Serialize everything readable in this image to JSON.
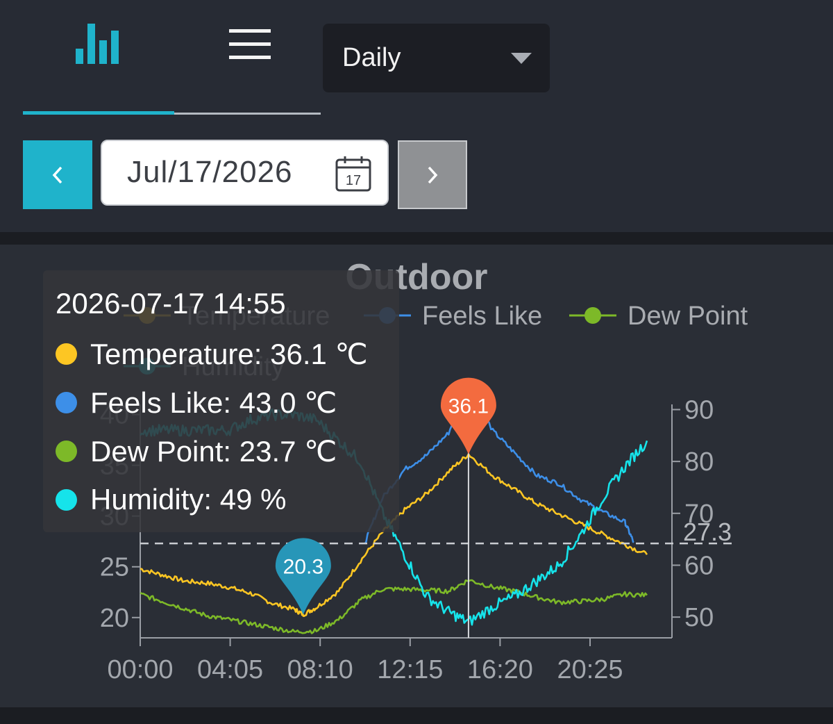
{
  "tabs": [
    {
      "name": "chart",
      "icon": "bar-chart-icon",
      "active": true
    },
    {
      "name": "list",
      "icon": "menu-icon",
      "active": false
    }
  ],
  "period_select": {
    "value": "Daily"
  },
  "date_nav": {
    "date": "Jul/17/2026",
    "calendar_day": "17"
  },
  "colors": {
    "accent": "#1fb3cb",
    "temperature": "#fdc623",
    "feels_like": "#3d8fe8",
    "dew_point": "#7db928",
    "humidity": "#16e3ea",
    "max_marker": "#f36b3f",
    "min_marker": "#2796b8"
  },
  "tooltip": {
    "time": "2026-07-17 14:55",
    "rows": [
      {
        "label": "Temperature: 36.1 ℃",
        "color": "#fdc623"
      },
      {
        "label": "Feels Like: 43.0 ℃",
        "color": "#3d8fe8"
      },
      {
        "label": "Dew Point: 23.7 ℃",
        "color": "#7db928"
      },
      {
        "label": "Humidity: 49 %",
        "color": "#16e3ea"
      }
    ]
  },
  "chart_data": {
    "type": "line",
    "title": "Outdoor",
    "legend": [
      "Temperature",
      "Feels Like",
      "Dew Point",
      "Humidity"
    ],
    "x_tick_labels": [
      "00:00",
      "04:05",
      "08:10",
      "12:15",
      "16:20",
      "20:25"
    ],
    "y_left_ticks": [
      "20",
      "25",
      "30",
      "35",
      "40"
    ],
    "y_right_ticks": [
      "50",
      "60",
      "70",
      "80",
      "90"
    ],
    "ylim_left": [
      18,
      41
    ],
    "ylim_right": [
      46,
      91
    ],
    "x_unit": "hours",
    "x_range": [
      0,
      24
    ],
    "mean_line": {
      "value": 27.3,
      "label": "27.3"
    },
    "max_marker": {
      "label": "36.1",
      "x": 14.9,
      "y": 36.1
    },
    "min_marker": {
      "label": "20.3",
      "x": 7.4,
      "y": 20.3
    },
    "crosshair_x": 14.9,
    "series": [
      {
        "name": "Temperature",
        "axis": "left",
        "points": [
          [
            0,
            24.8
          ],
          [
            1,
            24.2
          ],
          [
            2,
            23.6
          ],
          [
            3,
            23.4
          ],
          [
            4,
            23.0
          ],
          [
            5,
            22.4
          ],
          [
            6,
            21.4
          ],
          [
            7,
            20.8
          ],
          [
            7.4,
            20.3
          ],
          [
            8,
            21.0
          ],
          [
            9,
            22.6
          ],
          [
            10,
            25.6
          ],
          [
            11,
            28.4
          ],
          [
            12,
            30.6
          ],
          [
            13,
            32.2
          ],
          [
            14,
            34.4
          ],
          [
            14.9,
            36.1
          ],
          [
            16,
            34.0
          ],
          [
            17,
            32.6
          ],
          [
            18,
            31.2
          ],
          [
            19,
            30.2
          ],
          [
            20,
            29.2
          ],
          [
            21,
            28.2
          ],
          [
            22,
            27.2
          ],
          [
            23,
            26.2
          ]
        ]
      },
      {
        "name": "Feels Like",
        "axis": "left",
        "points": [
          [
            10.2,
            27.4
          ],
          [
            11,
            31.8
          ],
          [
            12,
            34.6
          ],
          [
            13,
            36.0
          ],
          [
            14,
            38.2
          ],
          [
            14.9,
            43.0
          ],
          [
            16,
            38.4
          ],
          [
            17,
            36.2
          ],
          [
            18,
            34.0
          ],
          [
            19,
            33.2
          ],
          [
            20,
            31.6
          ],
          [
            21,
            30.4
          ],
          [
            22,
            29.4
          ],
          [
            22.4,
            27.4
          ]
        ]
      },
      {
        "name": "Dew Point",
        "axis": "left",
        "points": [
          [
            0,
            22.3
          ],
          [
            1,
            21.6
          ],
          [
            2,
            20.9
          ],
          [
            3,
            20.2
          ],
          [
            4,
            19.8
          ],
          [
            5,
            19.4
          ],
          [
            6,
            19.0
          ],
          [
            7,
            18.6
          ],
          [
            8,
            18.7
          ],
          [
            9,
            19.8
          ],
          [
            10,
            21.7
          ],
          [
            11,
            22.8
          ],
          [
            12,
            22.8
          ],
          [
            13,
            22.7
          ],
          [
            14,
            22.6
          ],
          [
            14.9,
            23.7
          ],
          [
            16,
            23.0
          ],
          [
            17,
            22.6
          ],
          [
            18,
            22.0
          ],
          [
            19,
            21.5
          ],
          [
            20,
            21.6
          ],
          [
            21,
            21.8
          ],
          [
            22,
            22.3
          ],
          [
            23,
            22.2
          ]
        ]
      },
      {
        "name": "Humidity",
        "axis": "right",
        "points": [
          [
            0,
            86
          ],
          [
            1,
            86
          ],
          [
            2,
            86
          ],
          [
            3,
            86
          ],
          [
            4,
            86
          ],
          [
            5,
            88
          ],
          [
            6,
            89
          ],
          [
            7,
            89
          ],
          [
            8,
            88
          ],
          [
            9,
            84
          ],
          [
            10,
            80
          ],
          [
            11,
            70
          ],
          [
            12,
            62
          ],
          [
            13,
            54
          ],
          [
            14,
            51
          ],
          [
            14.9,
            49
          ],
          [
            16,
            52
          ],
          [
            17,
            54
          ],
          [
            18,
            57
          ],
          [
            19,
            60
          ],
          [
            20,
            66
          ],
          [
            21,
            73
          ],
          [
            22,
            79
          ],
          [
            23,
            84
          ]
        ]
      }
    ]
  }
}
